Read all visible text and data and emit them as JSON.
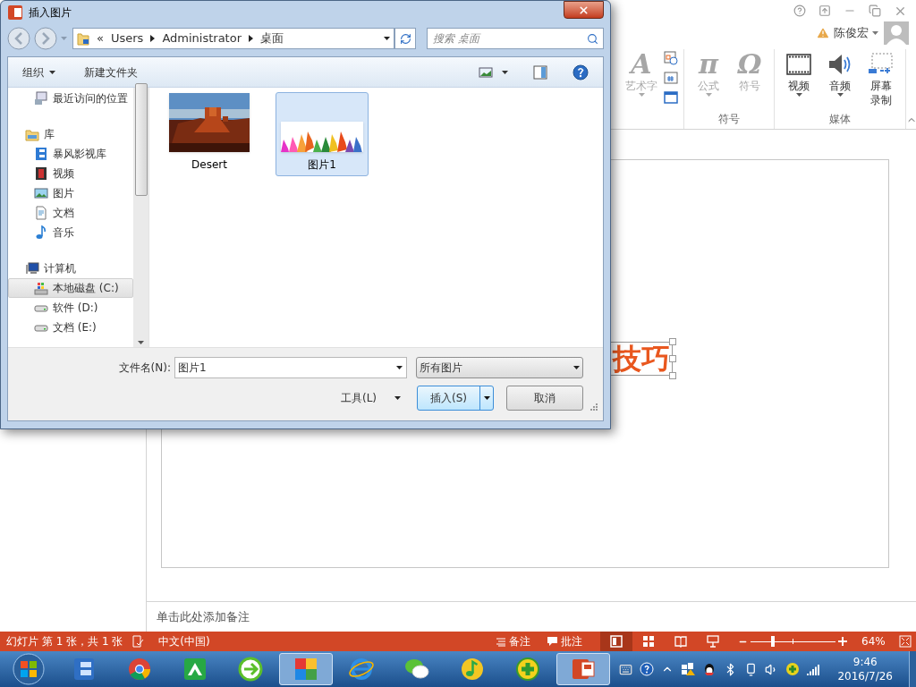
{
  "window": {
    "user_name": "陈俊宏"
  },
  "ribbon": {
    "groups": [
      {
        "items": [
          {
            "glyph": "A",
            "label": "艺术字",
            "disabled": true,
            "dropdown": true
          }
        ]
      },
      {
        "label": "符号",
        "items": [
          {
            "glyph": "π",
            "label": "公式",
            "disabled": true,
            "dropdown": true
          },
          {
            "glyph": "Ω",
            "label": "符号",
            "disabled": true,
            "dropdown": false
          }
        ]
      },
      {
        "label": "媒体",
        "items": [
          {
            "label": "视频",
            "disabled": false,
            "dropdown": true
          },
          {
            "label": "音频",
            "disabled": false,
            "dropdown": true
          },
          {
            "label": "屏幕录制",
            "disabled": false,
            "dropdown": false
          }
        ]
      }
    ]
  },
  "slide": {
    "text": "技巧",
    "selected": true
  },
  "notes_placeholder": "单击此处添加备注",
  "status_bar": {
    "slide_info": "幻灯片 第 1 张，共 1 张",
    "language": "中文(中国)",
    "notes": "备注",
    "comments": "批注",
    "views": [
      {
        "selected": true
      },
      {
        "selected": false
      },
      {
        "selected": false
      },
      {
        "selected": false
      }
    ],
    "zoom": {
      "level": 0.26
    },
    "zoom_percent": "64%"
  },
  "taskbar": {
    "apps": [
      {
        "active": false
      },
      {
        "active": false
      },
      {
        "active": false
      },
      {
        "active": false
      },
      {
        "active": true
      },
      {
        "active": false
      },
      {
        "active": false
      },
      {
        "active": false
      },
      {
        "active": false
      },
      {
        "active": true
      }
    ],
    "time": "9:46",
    "date": "2016/7/26"
  },
  "dialog": {
    "title": "插入图片",
    "address_prefix": "«",
    "address": [
      "Users",
      "Administrator",
      "桌面"
    ],
    "search_placeholder": "搜索 桌面",
    "organize": "组织",
    "new_folder": "新建文件夹",
    "nav": [
      {
        "kind": "item",
        "label": "最近访问的位置",
        "selected": false
      },
      {
        "kind": "group",
        "label": "库",
        "selected": false,
        "children": [
          {
            "label": "暴风影视库",
            "selected": false
          },
          {
            "label": "视频",
            "selected": false
          },
          {
            "label": "图片",
            "selected": false
          },
          {
            "label": "文档",
            "selected": false
          },
          {
            "label": "音乐",
            "selected": false
          }
        ]
      },
      {
        "kind": "group",
        "label": "计算机",
        "selected": false,
        "children": [
          {
            "label": "本地磁盘 (C:)",
            "selected": true
          },
          {
            "label": "软件 (D:)",
            "selected": false
          },
          {
            "label": "文档 (E:)",
            "selected": false
          }
        ]
      }
    ],
    "files": [
      {
        "name": "Desert",
        "selected": false
      },
      {
        "name": "图片1",
        "selected": true
      }
    ],
    "file_name_label": "文件名(N):",
    "file_name": "图片1",
    "file_type": "所有图片",
    "tools": "工具(L)",
    "insert": "插入(S)",
    "cancel": "取消"
  }
}
